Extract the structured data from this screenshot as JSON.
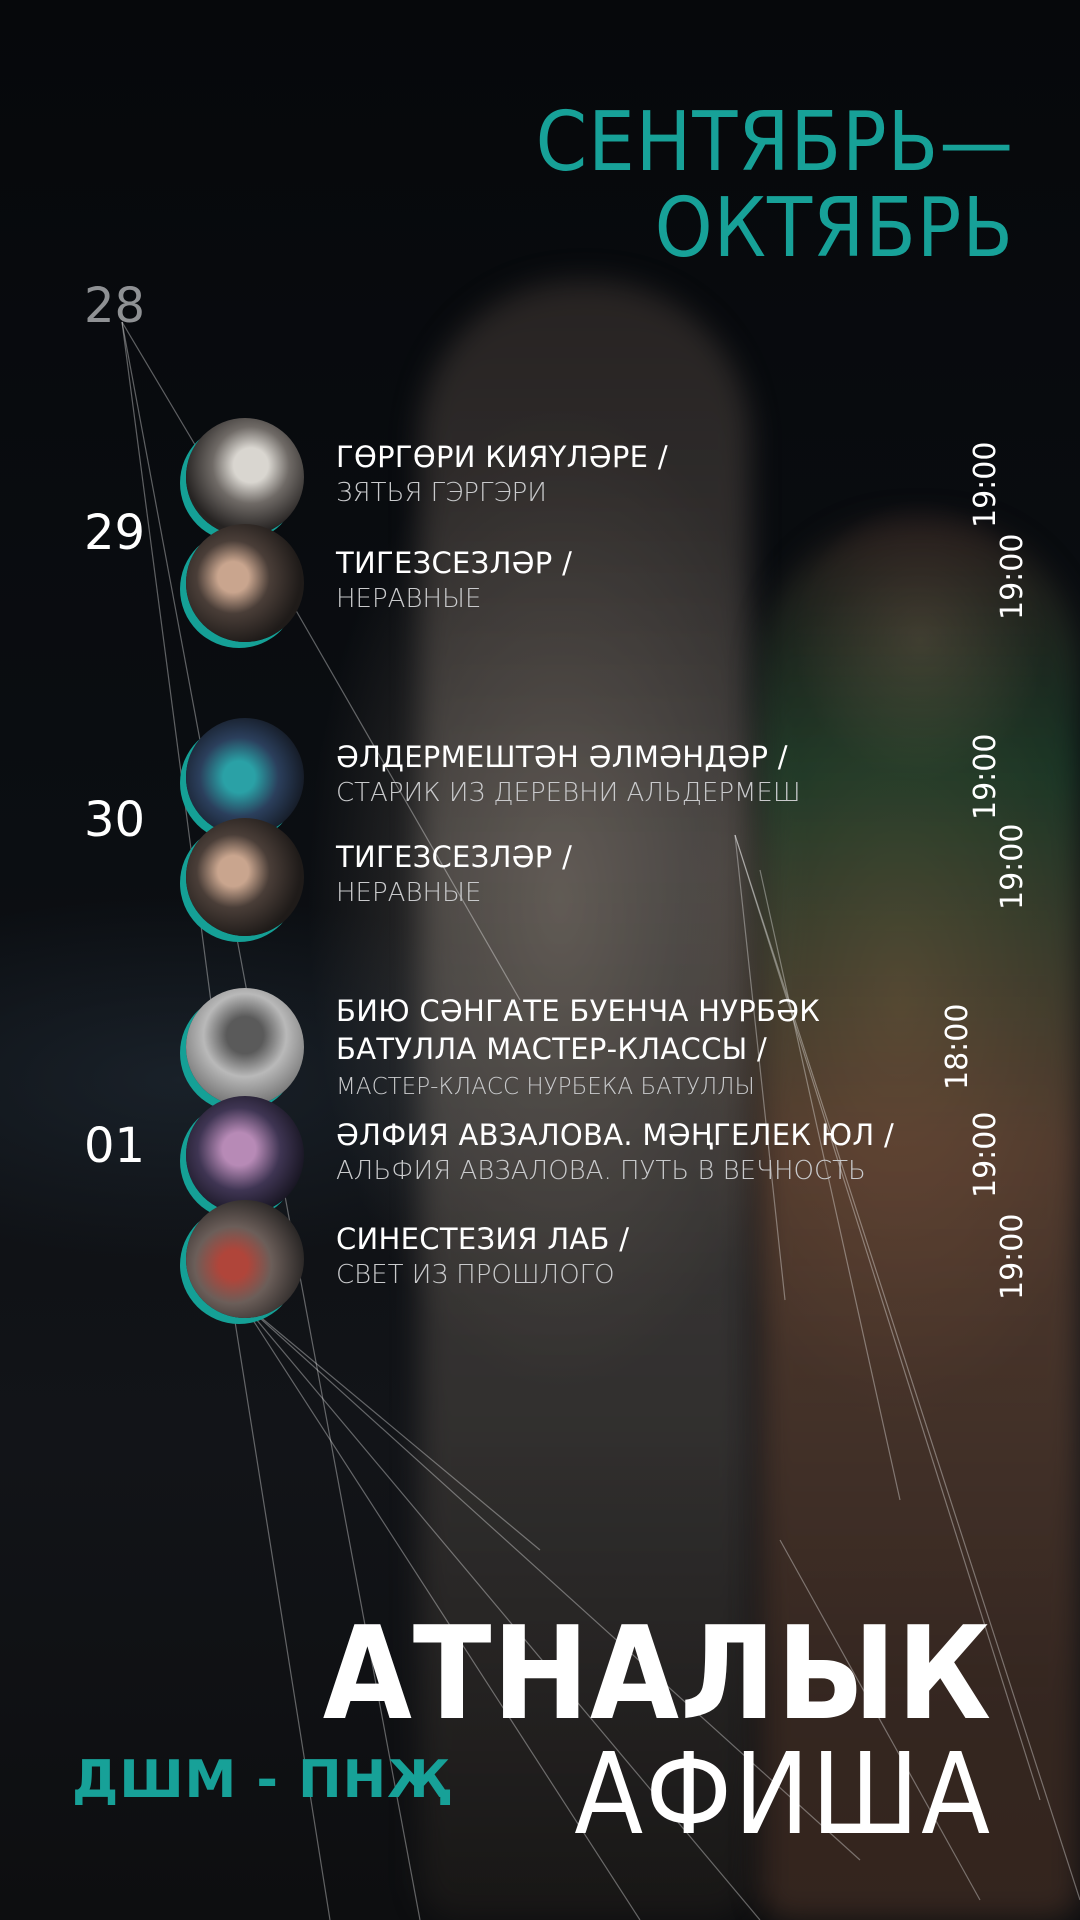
{
  "header": {
    "line1": "СЕНТЯБРЬ—",
    "line2": "ОКТЯБРЬ"
  },
  "dates": [
    "28",
    "29",
    "30",
    "01"
  ],
  "events": [
    {
      "title": "ГӨРГӨРИ КИЯҮЛӘРЕ /",
      "subtitle": "ЗЯТЬЯ ГЭРГЭРИ",
      "time": "19:00"
    },
    {
      "title": "ТИГЕЗСЕЗЛӘР /",
      "subtitle": "НЕРАВНЫЕ",
      "time": "19:00"
    },
    {
      "title": "ӘЛДЕРМЕШТӘН ӘЛМӘНДӘР /",
      "subtitle": "СТАРИК ИЗ ДЕРЕВНИ АЛЬДЕРМЕШ",
      "time": "19:00"
    },
    {
      "title": "ТИГЕЗСЕЗЛӘР /",
      "subtitle": "НЕРАВНЫЕ",
      "time": "19:00"
    },
    {
      "title_line1": "БИЮ СӘНГАТЕ БУЕНЧА НУРБӘК",
      "title_line2": "БАТУЛЛА МАСТЕР-КЛАССЫ /",
      "subtitle": "МАСТЕР-КЛАСС НУРБЕКА БАТУЛЛЫ",
      "time": "18:00"
    },
    {
      "title": "ӘЛФИЯ АВЗАЛОВА. МӘҢГЕЛЕК ЮЛ /",
      "subtitle": "АЛЬФИЯ АВЗАЛОВА. ПУТЬ В ВЕЧНОСТЬ",
      "time": "19:00"
    },
    {
      "title": "СИНЕСТЕЗИЯ ЛАБ /",
      "subtitle": "СВЕТ ИЗ ПРОШЛОГО",
      "time": "19:00"
    }
  ],
  "footer": {
    "theatre": "ДШМ - ПНҖ",
    "big_line1": "АТНАЛЫК",
    "big_line2": "АФИША"
  },
  "colors": {
    "accent": "#17a198",
    "text": "#ffffff",
    "muted": "#8f9194"
  }
}
